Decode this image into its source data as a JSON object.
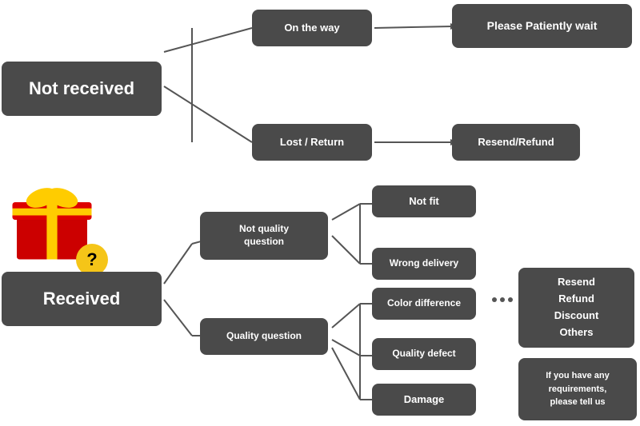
{
  "nodes": {
    "not_received": "Not received",
    "received": "Received",
    "on_the_way": "On the way",
    "please_wait": "Please Patiently wait",
    "lost_return": "Lost / Return",
    "resend_refund_top": "Resend/Refund",
    "not_quality_question": "Not quality\nquestion",
    "quality_question": "Quality question",
    "not_fit": "Not fit",
    "wrong_delivery": "Wrong delivery",
    "color_difference": "Color difference",
    "quality_defect": "Quality defect",
    "damage": "Damage",
    "options_box": "Resend\nRefund\nDiscount\nOthers",
    "requirements_box": "If you have any\nrequirements,\nplease tell us"
  }
}
